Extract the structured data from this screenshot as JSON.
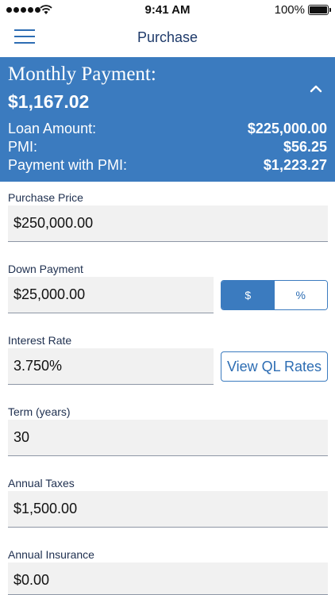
{
  "status_bar": {
    "time": "9:41 AM",
    "battery_percent": "100%"
  },
  "nav": {
    "title": "Purchase",
    "menu_icon": "hamburger-menu-icon"
  },
  "summary": {
    "title": "Monthly Payment:",
    "monthly_payment": "$1,167.02",
    "collapse_icon": "chevron-up-icon",
    "rows": [
      {
        "label": "Loan Amount:",
        "value": "$225,000.00"
      },
      {
        "label": "PMI:",
        "value": "$56.25"
      },
      {
        "label": "Payment with PMI:",
        "value": "$1,223.27"
      }
    ],
    "background_color": "#3b7bbf"
  },
  "form": {
    "purchase_price": {
      "label": "Purchase Price",
      "value": "$250,000.00"
    },
    "down_payment": {
      "label": "Down Payment",
      "value": "$25,000.00"
    },
    "down_payment_toggle": {
      "dollar": "$",
      "percent": "%",
      "selected": "$"
    },
    "interest_rate": {
      "label": "Interest Rate",
      "value": "3.750%"
    },
    "view_rates_button": "View QL Rates",
    "term": {
      "label": "Term (years)",
      "value": "30"
    },
    "annual_taxes": {
      "label": "Annual Taxes",
      "value": "$1,500.00"
    },
    "annual_insurance": {
      "label": "Annual Insurance",
      "value": "$0.00"
    }
  }
}
